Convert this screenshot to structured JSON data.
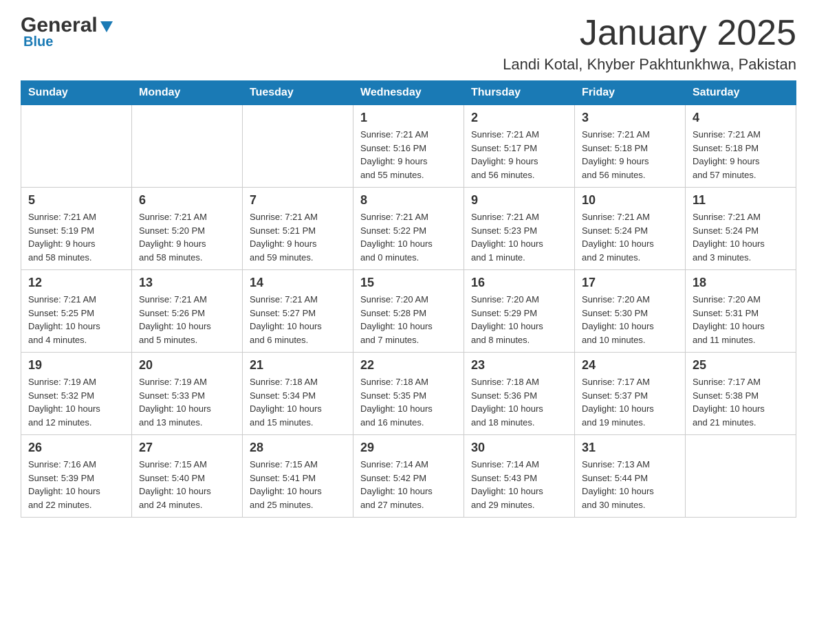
{
  "header": {
    "logo_general": "General",
    "logo_blue": "Blue",
    "month_title": "January 2025",
    "location": "Landi Kotal, Khyber Pakhtunkhwa, Pakistan"
  },
  "weekdays": [
    "Sunday",
    "Monday",
    "Tuesday",
    "Wednesday",
    "Thursday",
    "Friday",
    "Saturday"
  ],
  "weeks": [
    [
      {
        "day": "",
        "info": ""
      },
      {
        "day": "",
        "info": ""
      },
      {
        "day": "",
        "info": ""
      },
      {
        "day": "1",
        "info": "Sunrise: 7:21 AM\nSunset: 5:16 PM\nDaylight: 9 hours\nand 55 minutes."
      },
      {
        "day": "2",
        "info": "Sunrise: 7:21 AM\nSunset: 5:17 PM\nDaylight: 9 hours\nand 56 minutes."
      },
      {
        "day": "3",
        "info": "Sunrise: 7:21 AM\nSunset: 5:18 PM\nDaylight: 9 hours\nand 56 minutes."
      },
      {
        "day": "4",
        "info": "Sunrise: 7:21 AM\nSunset: 5:18 PM\nDaylight: 9 hours\nand 57 minutes."
      }
    ],
    [
      {
        "day": "5",
        "info": "Sunrise: 7:21 AM\nSunset: 5:19 PM\nDaylight: 9 hours\nand 58 minutes."
      },
      {
        "day": "6",
        "info": "Sunrise: 7:21 AM\nSunset: 5:20 PM\nDaylight: 9 hours\nand 58 minutes."
      },
      {
        "day": "7",
        "info": "Sunrise: 7:21 AM\nSunset: 5:21 PM\nDaylight: 9 hours\nand 59 minutes."
      },
      {
        "day": "8",
        "info": "Sunrise: 7:21 AM\nSunset: 5:22 PM\nDaylight: 10 hours\nand 0 minutes."
      },
      {
        "day": "9",
        "info": "Sunrise: 7:21 AM\nSunset: 5:23 PM\nDaylight: 10 hours\nand 1 minute."
      },
      {
        "day": "10",
        "info": "Sunrise: 7:21 AM\nSunset: 5:24 PM\nDaylight: 10 hours\nand 2 minutes."
      },
      {
        "day": "11",
        "info": "Sunrise: 7:21 AM\nSunset: 5:24 PM\nDaylight: 10 hours\nand 3 minutes."
      }
    ],
    [
      {
        "day": "12",
        "info": "Sunrise: 7:21 AM\nSunset: 5:25 PM\nDaylight: 10 hours\nand 4 minutes."
      },
      {
        "day": "13",
        "info": "Sunrise: 7:21 AM\nSunset: 5:26 PM\nDaylight: 10 hours\nand 5 minutes."
      },
      {
        "day": "14",
        "info": "Sunrise: 7:21 AM\nSunset: 5:27 PM\nDaylight: 10 hours\nand 6 minutes."
      },
      {
        "day": "15",
        "info": "Sunrise: 7:20 AM\nSunset: 5:28 PM\nDaylight: 10 hours\nand 7 minutes."
      },
      {
        "day": "16",
        "info": "Sunrise: 7:20 AM\nSunset: 5:29 PM\nDaylight: 10 hours\nand 8 minutes."
      },
      {
        "day": "17",
        "info": "Sunrise: 7:20 AM\nSunset: 5:30 PM\nDaylight: 10 hours\nand 10 minutes."
      },
      {
        "day": "18",
        "info": "Sunrise: 7:20 AM\nSunset: 5:31 PM\nDaylight: 10 hours\nand 11 minutes."
      }
    ],
    [
      {
        "day": "19",
        "info": "Sunrise: 7:19 AM\nSunset: 5:32 PM\nDaylight: 10 hours\nand 12 minutes."
      },
      {
        "day": "20",
        "info": "Sunrise: 7:19 AM\nSunset: 5:33 PM\nDaylight: 10 hours\nand 13 minutes."
      },
      {
        "day": "21",
        "info": "Sunrise: 7:18 AM\nSunset: 5:34 PM\nDaylight: 10 hours\nand 15 minutes."
      },
      {
        "day": "22",
        "info": "Sunrise: 7:18 AM\nSunset: 5:35 PM\nDaylight: 10 hours\nand 16 minutes."
      },
      {
        "day": "23",
        "info": "Sunrise: 7:18 AM\nSunset: 5:36 PM\nDaylight: 10 hours\nand 18 minutes."
      },
      {
        "day": "24",
        "info": "Sunrise: 7:17 AM\nSunset: 5:37 PM\nDaylight: 10 hours\nand 19 minutes."
      },
      {
        "day": "25",
        "info": "Sunrise: 7:17 AM\nSunset: 5:38 PM\nDaylight: 10 hours\nand 21 minutes."
      }
    ],
    [
      {
        "day": "26",
        "info": "Sunrise: 7:16 AM\nSunset: 5:39 PM\nDaylight: 10 hours\nand 22 minutes."
      },
      {
        "day": "27",
        "info": "Sunrise: 7:15 AM\nSunset: 5:40 PM\nDaylight: 10 hours\nand 24 minutes."
      },
      {
        "day": "28",
        "info": "Sunrise: 7:15 AM\nSunset: 5:41 PM\nDaylight: 10 hours\nand 25 minutes."
      },
      {
        "day": "29",
        "info": "Sunrise: 7:14 AM\nSunset: 5:42 PM\nDaylight: 10 hours\nand 27 minutes."
      },
      {
        "day": "30",
        "info": "Sunrise: 7:14 AM\nSunset: 5:43 PM\nDaylight: 10 hours\nand 29 minutes."
      },
      {
        "day": "31",
        "info": "Sunrise: 7:13 AM\nSunset: 5:44 PM\nDaylight: 10 hours\nand 30 minutes."
      },
      {
        "day": "",
        "info": ""
      }
    ]
  ]
}
